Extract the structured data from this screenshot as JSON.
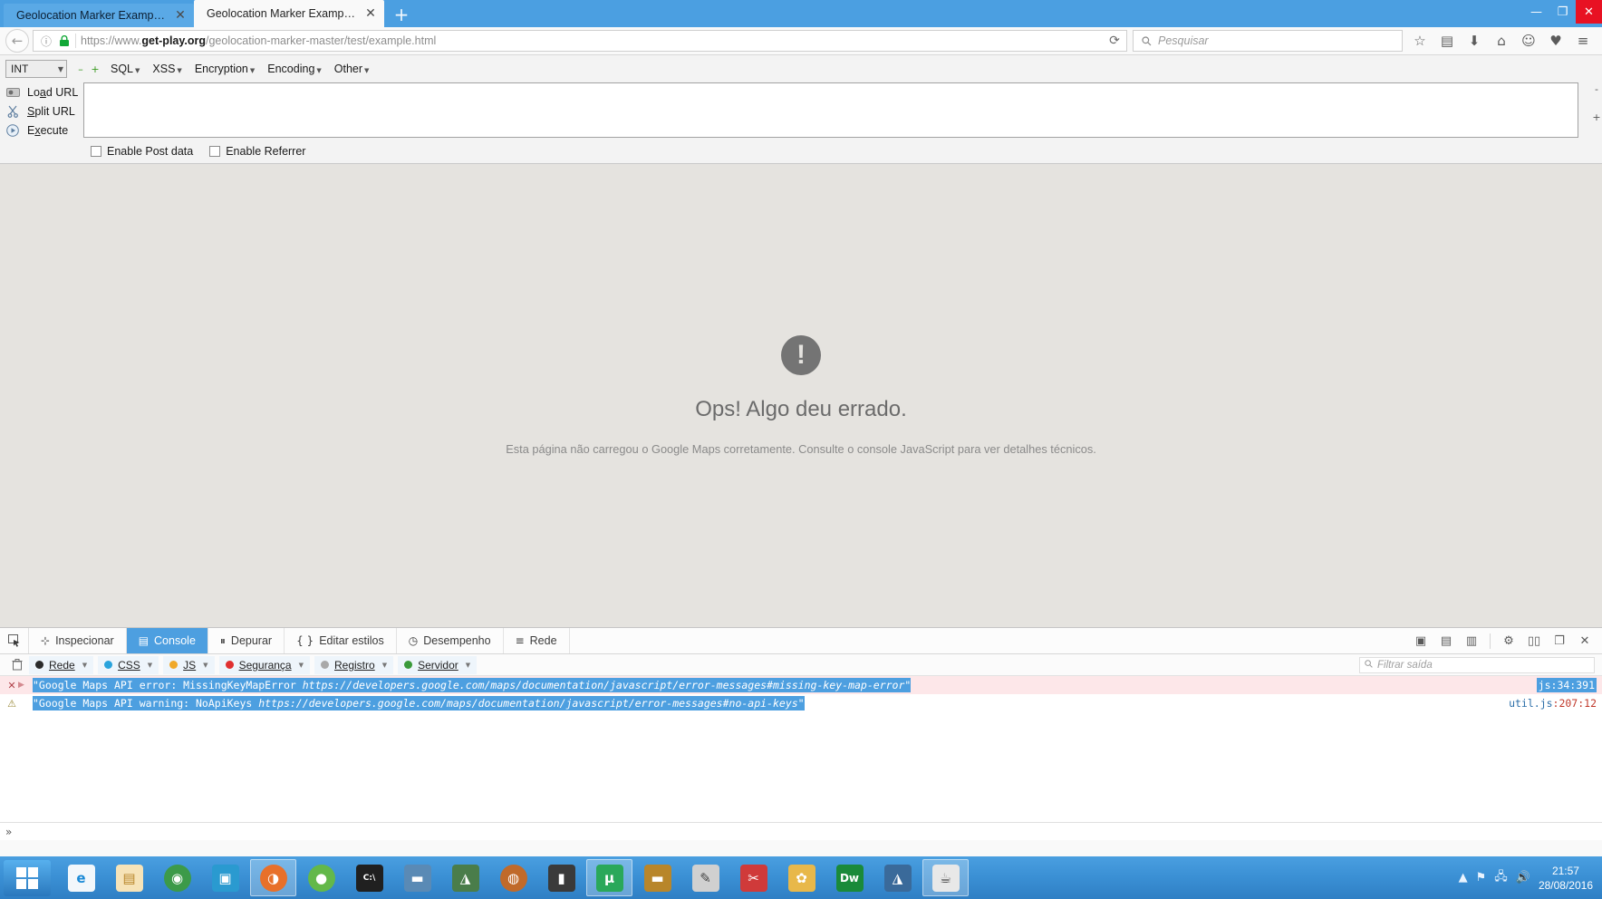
{
  "window": {
    "tabs": [
      {
        "title": "Geolocation Marker Example ...",
        "active": false
      },
      {
        "title": "Geolocation Marker Example ...",
        "active": true
      }
    ],
    "new_tab_label": "+",
    "controls": {
      "minimize": "—",
      "maximize": "❐",
      "close": "✕"
    }
  },
  "navbar": {
    "back_icon": "←",
    "info_icon": "ⓘ",
    "lock_icon": "🔒",
    "url_prefix": "https://www.",
    "url_domain": "get-play.org",
    "url_path": "/geolocation-marker-master/test/example.html",
    "reload_icon": "⟳",
    "search_placeholder": "Pesquisar",
    "search_icon": "🔍",
    "icons": [
      "☆",
      "▤",
      "⬇",
      "⌂",
      "☺",
      "♥",
      "≡"
    ]
  },
  "hackbar": {
    "mode_select": "INT",
    "minus_label": "–",
    "plus_label": "+",
    "menus": [
      "SQL",
      "XSS",
      "Encryption",
      "Encoding",
      "Other"
    ],
    "actions": [
      {
        "label": "Load URL",
        "accel": "a"
      },
      {
        "label": "Split URL",
        "accel": "p"
      },
      {
        "label": "Execute",
        "accel": "x"
      }
    ],
    "textarea_value": "",
    "checkboxes": [
      {
        "label": "Enable Post data",
        "checked": false
      },
      {
        "label": "Enable Referrer",
        "checked": false
      }
    ],
    "spinner": {
      "up": "-",
      "down": "+"
    }
  },
  "page": {
    "error_icon": "!",
    "title": "Ops! Algo deu errado.",
    "description": "Esta página não carregou o Google Maps corretamente. Consulte o console JavaScript para ver detalhes técnicos."
  },
  "devtools": {
    "picker_icon": "⬚",
    "tabs": [
      {
        "label": "Inspecionar",
        "icon": "⊹",
        "selected": false
      },
      {
        "label": "Console",
        "icon": "▤",
        "selected": true
      },
      {
        "label": "Depurar",
        "icon": "⏸",
        "selected": false
      },
      {
        "label": "Editar estilos",
        "icon": "{ }",
        "selected": false
      },
      {
        "label": "Desempenho",
        "icon": "◷",
        "selected": false
      },
      {
        "label": "Rede",
        "icon": "≡",
        "selected": false
      }
    ],
    "right_icons": [
      "▣",
      "▤",
      "▥",
      "⚙",
      "▯▯",
      "❐",
      "✕"
    ],
    "filters": [
      {
        "label": "Rede",
        "color": "#2b2b2b"
      },
      {
        "label": "CSS",
        "color": "#29a3dc"
      },
      {
        "label": "JS",
        "color": "#f0a92a"
      },
      {
        "label": "Segurança",
        "color": "#e03030"
      },
      {
        "label": "Registro",
        "color": "#a9a9a9"
      },
      {
        "label": "Servidor",
        "color": "#3a9a3a"
      }
    ],
    "filter_placeholder": "Filtrar saída",
    "filter_search_icon": "🔍",
    "messages": [
      {
        "level": "error",
        "gutter_icon": "✕",
        "arrow_icon": "▶",
        "text_plain": "\"Google Maps API error: MissingKeyMapError ",
        "text_url": "https://developers.google.com/maps/documentation/javascript/error-messages#missing-key-map-error\"",
        "source_file": "js",
        "source_line": ":34:391",
        "source_selected": true
      },
      {
        "level": "warning",
        "gutter_icon": "⚠",
        "arrow_icon": "",
        "text_plain": "\"Google Maps API warning: NoApiKeys ",
        "text_url": "https://developers.google.com/maps/documentation/javascript/error-messages#no-api-keys\"",
        "source_file": "util.js",
        "source_line": ":207:12",
        "source_selected": false
      }
    ],
    "footer_icon": "»"
  },
  "taskbar": {
    "start_label": "Start",
    "apps": [
      {
        "name": "internet-explorer",
        "glyph": "e",
        "color": "#1b8ad6",
        "bg": "#f2f7fb",
        "active": false
      },
      {
        "name": "file-explorer",
        "glyph": "▤",
        "color": "#e0a33a",
        "bg": "#f6e3b8",
        "active": false
      },
      {
        "name": "google-chrome",
        "glyph": "◉",
        "color": "#ffffff",
        "bg": "#3c9a49",
        "active": false
      },
      {
        "name": "unknown-app",
        "glyph": "▣",
        "color": "#ffffff",
        "bg": "#2a9ad0",
        "active": false
      },
      {
        "name": "mozilla-firefox",
        "glyph": "◑",
        "color": "#ffffff",
        "bg": "#e8702a",
        "active": true
      },
      {
        "name": "green-app",
        "glyph": "●",
        "color": "#ffffff",
        "bg": "#63b84a",
        "active": false
      },
      {
        "name": "terminal",
        "glyph": "C:\\",
        "color": "#ffffff",
        "bg": "#202020",
        "active": false
      },
      {
        "name": "laptop-app",
        "glyph": "▬",
        "color": "#ffffff",
        "bg": "#5a8ab5",
        "active": false
      },
      {
        "name": "android-studio",
        "glyph": "◮",
        "color": "#ffffff",
        "bg": "#4a7d4a",
        "active": false
      },
      {
        "name": "globe-app",
        "glyph": "◍",
        "color": "#ffffff",
        "bg": "#c06a2a",
        "active": false
      },
      {
        "name": "usb-drive",
        "glyph": "▮",
        "color": "#ffffff",
        "bg": "#3a3a3a",
        "active": false
      },
      {
        "name": "utorrent",
        "glyph": "µ",
        "color": "#ffffff",
        "bg": "#2aa85a",
        "active": true
      },
      {
        "name": "briefcase-app",
        "glyph": "▬",
        "color": "#ffffff",
        "bg": "#b8862a",
        "active": false
      },
      {
        "name": "notes-app",
        "glyph": "✎",
        "color": "#ffffff",
        "bg": "#d0d0d0",
        "active": false
      },
      {
        "name": "red-tool-app",
        "glyph": "✂",
        "color": "#ffffff",
        "bg": "#d03a3a",
        "active": false
      },
      {
        "name": "paint-app",
        "glyph": "✿",
        "color": "#ffffff",
        "bg": "#e8b84a",
        "active": false
      },
      {
        "name": "dreamweaver",
        "glyph": "Dw",
        "color": "#ffffff",
        "bg": "#1a8a3a",
        "active": false
      },
      {
        "name": "android-app",
        "glyph": "◮",
        "color": "#ffffff",
        "bg": "#3a6a9a",
        "active": false
      },
      {
        "name": "java-app",
        "glyph": "☕",
        "color": "#ffffff",
        "bg": "#e8e8e8",
        "active": true
      }
    ],
    "tray": {
      "show_hidden_icon": "▲",
      "network_flag_icon": "⚑",
      "network_icon": "🖧",
      "volume_icon": "🔊",
      "time": "21:57",
      "date": "28/08/2016"
    }
  }
}
